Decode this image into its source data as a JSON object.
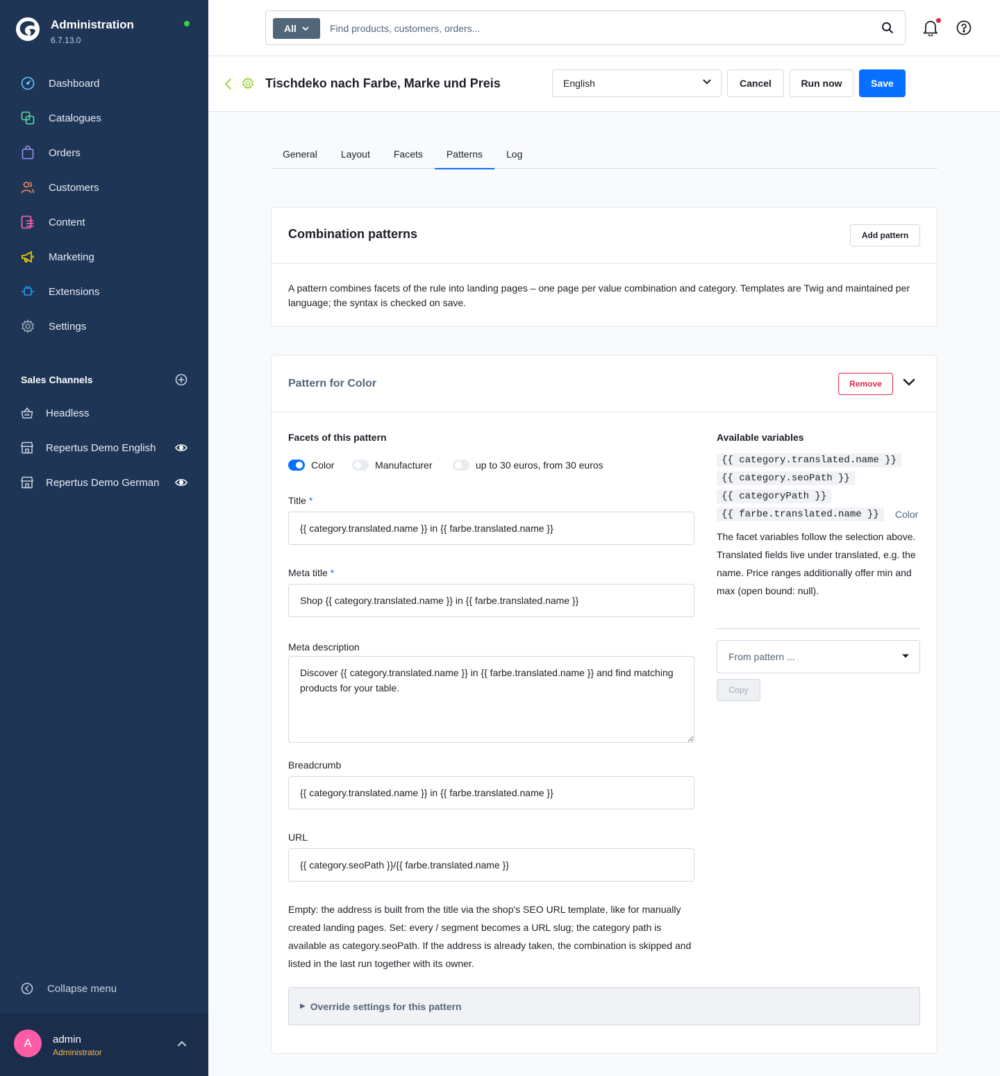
{
  "app": {
    "title": "Administration",
    "version": "6.7.13.0",
    "status_color": "#37d046"
  },
  "sidebar": {
    "items": [
      {
        "label": "Dashboard",
        "icon": "gauge-icon",
        "color": "#5ec8ff"
      },
      {
        "label": "Catalogues",
        "icon": "catalogue-icon",
        "color": "#57d9a3"
      },
      {
        "label": "Orders",
        "icon": "shopping-bag-icon",
        "color": "#a092f0"
      },
      {
        "label": "Customers",
        "icon": "users-icon",
        "color": "#f88962"
      },
      {
        "label": "Content",
        "icon": "content-icon",
        "color": "#ff68b4"
      },
      {
        "label": "Marketing",
        "icon": "megaphone-icon",
        "color": "#ffd700"
      },
      {
        "label": "Extensions",
        "icon": "plug-icon",
        "color": "#189eff"
      },
      {
        "label": "Settings",
        "icon": "gear-icon",
        "color": "#9aa8b5"
      }
    ],
    "sales_channels_title": "Sales Channels",
    "sales_channels": [
      {
        "label": "Headless",
        "icon": "basket-icon",
        "visible_toggle": false
      },
      {
        "label": "Repertus Demo English",
        "icon": "storefront-icon",
        "visible_toggle": true
      },
      {
        "label": "Repertus Demo German",
        "icon": "storefront-icon",
        "visible_toggle": true
      }
    ],
    "collapse_label": "Collapse menu",
    "user": {
      "initial": "A",
      "name": "admin",
      "role": "Administrator"
    }
  },
  "topbar": {
    "search_scope": "All",
    "search_placeholder": "Find products, customers, orders..."
  },
  "header": {
    "title": "Tischdeko nach Farbe, Marke und Preis",
    "language": "English",
    "cancel": "Cancel",
    "run_now": "Run now",
    "save": "Save",
    "accent": "#0870ff"
  },
  "tabs": [
    {
      "label": "General",
      "active": false
    },
    {
      "label": "Layout",
      "active": false
    },
    {
      "label": "Facets",
      "active": false
    },
    {
      "label": "Patterns",
      "active": true
    },
    {
      "label": "Log",
      "active": false
    }
  ],
  "combination": {
    "title": "Combination patterns",
    "add_button": "Add pattern",
    "description": "A pattern combines facets of the rule into landing pages – one page per value combination and category. Templates are Twig and maintained per language; the syntax is checked on save."
  },
  "pattern": {
    "title": "Pattern for Color",
    "remove_button": "Remove",
    "facets_label": "Facets of this pattern",
    "facets": [
      {
        "label": "Color",
        "on": true
      },
      {
        "label": "Manufacturer",
        "on": false
      },
      {
        "label": "up to 30 euros, from 30 euros",
        "on": false
      }
    ],
    "fields": {
      "title_label": "Title",
      "title_value": "{{ category.translated.name }} in {{ farbe.translated.name }}",
      "meta_title_label": "Meta title",
      "meta_title_value": "Shop {{ category.translated.name }} in {{ farbe.translated.name }}",
      "meta_description_label": "Meta description",
      "meta_description_value": "Discover {{ category.translated.name }} in {{ farbe.translated.name }} and find matching products for your table.",
      "breadcrumb_label": "Breadcrumb",
      "breadcrumb_value": "{{ category.translated.name }} in {{ farbe.translated.name }}",
      "url_label": "URL",
      "url_value": "{{ category.seoPath }}/{{ farbe.translated.name }}",
      "required_mark": "*"
    },
    "url_help": "Empty: the address is built from the title via the shop's SEO URL template, like for manually created landing pages. Set: every / segment becomes a URL slug; the category path is available as category.seoPath. If the address is already taken, the combination is skipped and listed in the last run together with its owner.",
    "override_label": "Override settings for this pattern",
    "variables_label": "Available variables",
    "variables": [
      {
        "code": "{{ category.translated.name }}",
        "note": ""
      },
      {
        "code": "{{ category.seoPath }}",
        "note": ""
      },
      {
        "code": "{{ categoryPath }}",
        "note": ""
      },
      {
        "code": "{{ farbe.translated.name }}",
        "note": "Color"
      }
    ],
    "variables_desc": "The facet variables follow the selection above. Translated fields live under translated, e.g. the name. Price ranges additionally offer min and max (open bound: null).",
    "from_pattern_placeholder": "From pattern ...",
    "copy_button": "Copy"
  }
}
